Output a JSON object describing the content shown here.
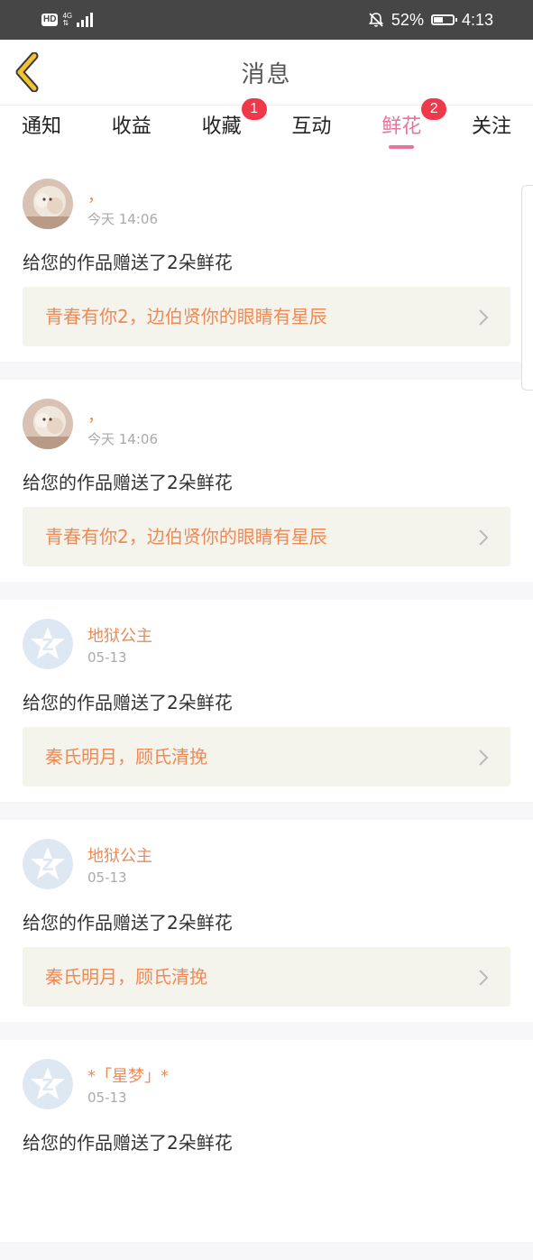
{
  "status_bar": {
    "hd": "HD",
    "network_top": "4G",
    "network_bottom": "⇅",
    "battery_percent": "52%",
    "battery_level": 0.52,
    "time": "4:13"
  },
  "header": {
    "title": "消息"
  },
  "tabs": [
    {
      "label": "通知",
      "badge": "",
      "active": false
    },
    {
      "label": "收益",
      "badge": "",
      "active": false
    },
    {
      "label": "收藏",
      "badge": "1",
      "active": false
    },
    {
      "label": "互动",
      "badge": "",
      "active": false
    },
    {
      "label": "鲜花",
      "badge": "2",
      "active": true
    },
    {
      "label": "关注",
      "badge": "",
      "active": false
    }
  ],
  "messages": [
    {
      "user": "，",
      "time": "今天 14:06",
      "text": "给您的作品赠送了2朵鲜花",
      "work": "青春有你2，边伯贤你的眼睛有星辰",
      "avatar": "photo-avatar"
    },
    {
      "user": "，",
      "time": "今天 14:06",
      "text": "给您的作品赠送了2朵鲜花",
      "work": "青春有你2，边伯贤你的眼睛有星辰",
      "avatar": "photo-avatar"
    },
    {
      "user": "地狱公主",
      "time": "05-13",
      "text": "给您的作品赠送了2朵鲜花",
      "work": "秦氏明月，顾氏清挽",
      "avatar": "default-avatar"
    },
    {
      "user": "地狱公主",
      "time": "05-13",
      "text": "给您的作品赠送了2朵鲜花",
      "work": "秦氏明月，顾氏清挽",
      "avatar": "default-avatar"
    },
    {
      "user": "*「星梦」*",
      "time": "05-13",
      "text": "给您的作品赠送了2朵鲜花",
      "work": "",
      "avatar": "default-avatar"
    }
  ],
  "colors": {
    "accent_pink": "#e8739b",
    "username_orange": "#ee8a56",
    "badge_red": "#f0384b",
    "link_bg": "#f4f3ec",
    "back_icon_yellow": "#f2c230"
  }
}
